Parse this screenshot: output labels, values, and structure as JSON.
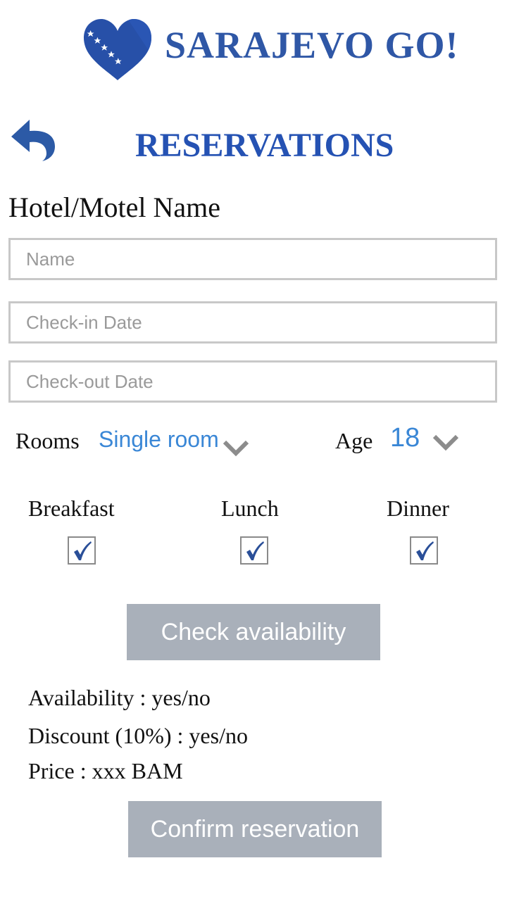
{
  "header": {
    "brand": "SARAJEVO GO!",
    "logo_icon": "heart-flag-icon",
    "brand_color": "#2f57a6"
  },
  "title_bar": {
    "back_icon": "back-arrow-icon",
    "title": "RESERVATIONS",
    "title_color": "#2552b3"
  },
  "form": {
    "section_label": "Hotel/Motel Name",
    "name_placeholder": "Name",
    "checkin_placeholder": "Check-in Date",
    "checkout_placeholder": "Check-out Date",
    "rooms_label": "Rooms",
    "rooms_value": "Single room",
    "age_label": "Age",
    "age_value": "18",
    "value_color": "#3a87d6"
  },
  "meals": [
    {
      "label": "Breakfast",
      "checked": true
    },
    {
      "label": "Lunch",
      "checked": true
    },
    {
      "label": "Dinner",
      "checked": true
    }
  ],
  "actions": {
    "check_availability": "Check availability",
    "confirm_reservation": "Confirm reservation",
    "button_color": "#a9b0ba"
  },
  "results": {
    "availability": "Availability : yes/no",
    "discount": "Discount (10%) : yes/no",
    "price": "Price : xxx BAM"
  }
}
